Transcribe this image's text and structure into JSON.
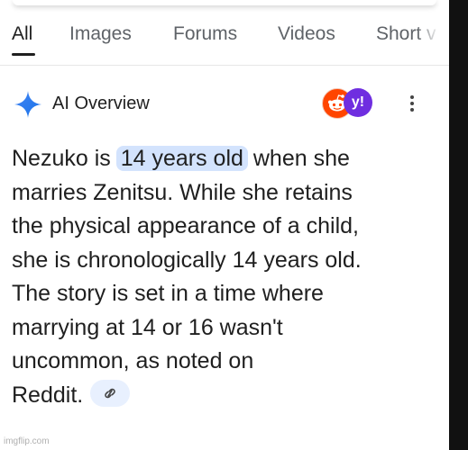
{
  "tabs": [
    {
      "label": "All",
      "active": true
    },
    {
      "label": "Images",
      "active": false
    },
    {
      "label": "Forums",
      "active": false
    },
    {
      "label": "Videos",
      "active": false
    },
    {
      "label": "Short v",
      "active": false
    }
  ],
  "ai_overview": {
    "title": "AI Overview",
    "sources": [
      {
        "name": "Reddit",
        "icon": "reddit-icon",
        "color": "#ff4500"
      },
      {
        "name": "Yahoo",
        "icon": "yahoo-icon",
        "glyph": "y!",
        "color": "#6f2ee0"
      }
    ],
    "answer": {
      "line1_before": "Nezuko is",
      "highlight": "14 years old",
      "line1_after": "when she",
      "line2": "marries Zenitsu. While she retains",
      "line3": "the physical appearance of a child,",
      "line4": "she is chronologically 14 years old.",
      "line5": "The story is set in a time where",
      "line6": "marrying at 14 or 16 wasn't",
      "line7": "uncommon, as noted on",
      "line8": "Reddit."
    },
    "highlight_color": "#d3e3fd",
    "link_chip_icon": "link-icon"
  },
  "watermark": "imgflip.com"
}
